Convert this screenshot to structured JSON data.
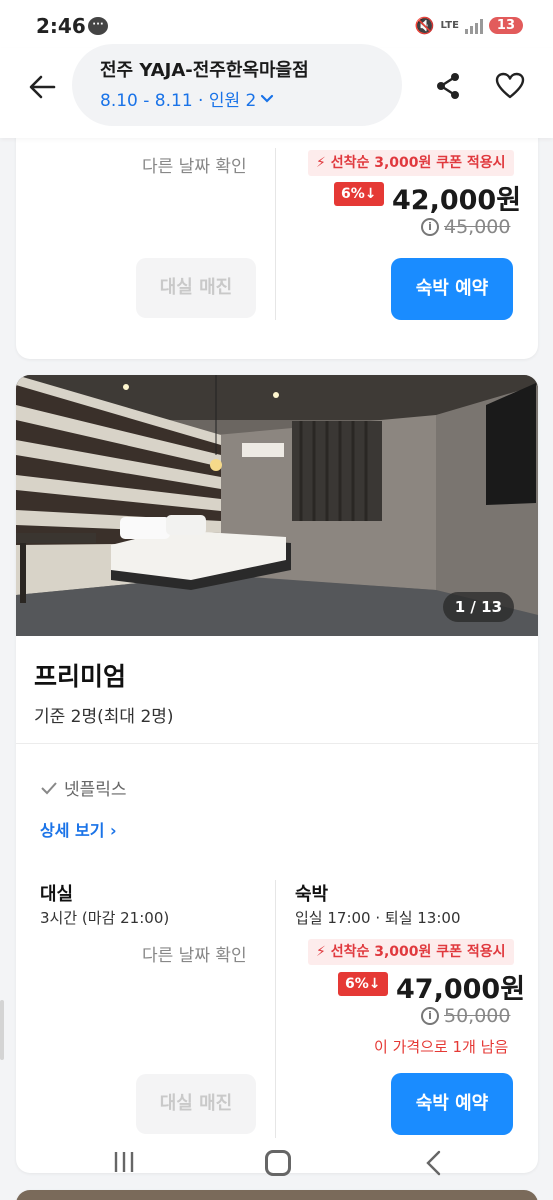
{
  "status_bar": {
    "time": "2:46",
    "network": "LTE",
    "battery": "13"
  },
  "header": {
    "hotel_name": "전주 YAJA-전주한옥마을점",
    "dates_guests": "8.10 - 8.11 · 인원 2"
  },
  "rooms": [
    {
      "rental": {
        "other_date": "다른 날짜 확인",
        "soldout_label": "대실 매진"
      },
      "stay": {
        "coupon": "선착순 3,000원 쿠폰 적용시",
        "discount": "6%",
        "price": "42,000원",
        "original_price": "45,000",
        "book_label": "숙박 예약"
      }
    },
    {
      "photo_counter": "1 / 13",
      "name": "프리미엄",
      "capacity": "기준 2명(최대 2명)",
      "amenity": "넷플릭스",
      "detail_link": "상세 보기",
      "rental": {
        "title": "대실",
        "hours": "3시간 (마감 21:00)",
        "other_date": "다른 날짜 확인",
        "soldout_label": "대실 매진"
      },
      "stay": {
        "title": "숙박",
        "times": "입실 17:00 · 퇴실 13:00",
        "coupon": "선착순 3,000원 쿠폰 적용시",
        "discount": "6%",
        "price": "47,000원",
        "original_price": "50,000",
        "remaining": "이 가격으로 1개 남음",
        "book_label": "숙박 예약"
      }
    }
  ],
  "colors": {
    "accent_blue": "#1a8cff",
    "link_blue": "#1a73e8",
    "discount_red": "#e53935",
    "coupon_bg": "#fdecec"
  }
}
